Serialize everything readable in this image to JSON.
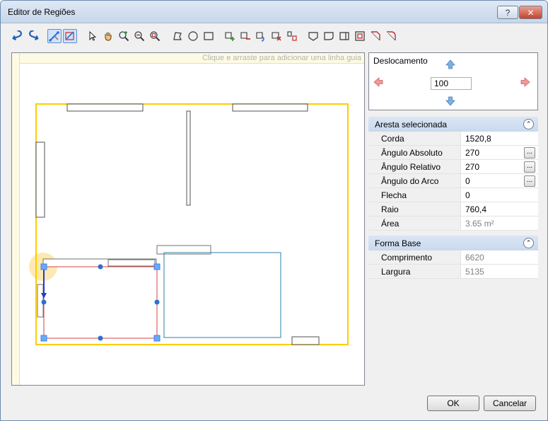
{
  "window": {
    "title": "Editor de Regiões",
    "help_label": "?",
    "close_label": "✕"
  },
  "toolbar": {
    "tools": [
      "undo-icon",
      "redo-icon",
      "select-edge-icon",
      "select-shape-icon",
      "pointer-icon",
      "pan-hand-icon",
      "zoom-in-icon",
      "zoom-out-icon",
      "zoom-fit-icon",
      "polygon-icon",
      "circle-icon",
      "rectangle-icon",
      "add-region-icon",
      "subtract-region-icon",
      "intersect-region-icon",
      "remove-region-icon",
      "split-icon",
      "shape-1-icon",
      "shape-2-icon",
      "shape-3-icon",
      "shape-4-icon",
      "chamfer-icon",
      "fillet-icon"
    ]
  },
  "canvas": {
    "guide_hint": "Clique e arraste para adicionar uma linha guia",
    "colors": {
      "room_border": "#ffcc00",
      "selection": "#d94040",
      "handle": "#3b82f6",
      "wall": "#505050"
    }
  },
  "displacement": {
    "label": "Deslocamento",
    "value": "100"
  },
  "selected_edge": {
    "header": "Aresta selecionada",
    "collapse": "⌃",
    "rows": [
      {
        "name": "Corda",
        "value": "1520,8"
      },
      {
        "name": "Ângulo Absoluto",
        "value": "270",
        "button": "..."
      },
      {
        "name": "Ângulo Relativo",
        "value": "270",
        "button": "..."
      },
      {
        "name": "Ângulo do Arco",
        "value": "0",
        "button": "..."
      },
      {
        "name": "Flecha",
        "value": "0"
      },
      {
        "name": "Raio",
        "value": "760,4"
      },
      {
        "name": "Área",
        "value": "3.65 m²"
      }
    ]
  },
  "base_shape": {
    "header": "Forma Base",
    "collapse": "⌃",
    "rows": [
      {
        "name": "Comprimento",
        "value": "6620"
      },
      {
        "name": "Largura",
        "value": "5135"
      }
    ]
  },
  "buttons": {
    "ok": "OK",
    "cancel": "Cancelar"
  }
}
